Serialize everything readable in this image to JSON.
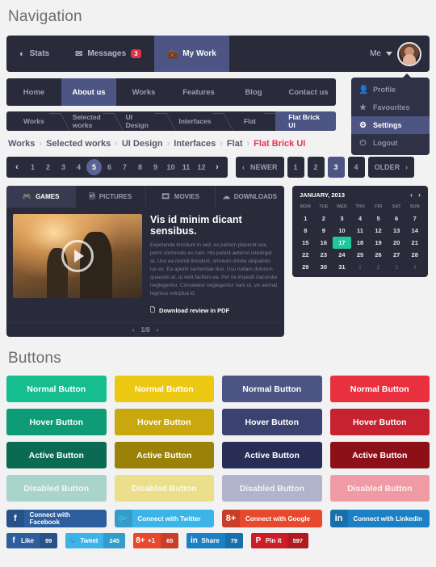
{
  "sections": {
    "navigation_title": "Navigation",
    "buttons_title": "Buttons"
  },
  "topbar": {
    "items": [
      {
        "label": "Stats",
        "icon": "chart-icon",
        "badge": null,
        "active": false
      },
      {
        "label": "Messages",
        "icon": "envelope-icon",
        "badge": "3",
        "active": false
      },
      {
        "label": "My Work",
        "icon": "briefcase-icon",
        "badge": null,
        "active": true
      }
    ],
    "user_label": "Me"
  },
  "dropdown": {
    "items": [
      {
        "label": "Profile",
        "icon": "user-icon",
        "active": false
      },
      {
        "label": "Favourites",
        "icon": "star-icon",
        "active": false
      },
      {
        "label": "Settings",
        "icon": "gear-icon",
        "active": true
      },
      {
        "label": "Logout",
        "icon": "power-icon",
        "active": false
      }
    ]
  },
  "mainnav": {
    "items": [
      {
        "label": "Home",
        "active": false
      },
      {
        "label": "About us",
        "active": true
      },
      {
        "label": "Works",
        "active": false
      },
      {
        "label": "Features",
        "active": false
      },
      {
        "label": "Blog",
        "active": false
      },
      {
        "label": "Contact us",
        "active": false
      }
    ]
  },
  "arrowbar": {
    "items": [
      {
        "label": "Works",
        "active": false
      },
      {
        "label": "Selected works",
        "active": false
      },
      {
        "label": "UI Design",
        "active": false
      },
      {
        "label": "Interfaces",
        "active": false
      },
      {
        "label": "Flat",
        "active": false
      },
      {
        "label": "Flat Brick UI",
        "active": true
      }
    ]
  },
  "crumbs": {
    "items": [
      "Works",
      "Selected works",
      "UI Design",
      "Interfaces",
      "Flat"
    ],
    "current": "Flat Brick UI",
    "separator": "›"
  },
  "pagination": {
    "prev_icon": "‹",
    "next_icon": "›",
    "pages": [
      "1",
      "2",
      "3",
      "4",
      "5",
      "6",
      "7",
      "8",
      "9",
      "10",
      "11",
      "12"
    ],
    "selected": "5"
  },
  "pagination2": {
    "newer_label": "NEWER",
    "older_label": "OLDER",
    "prev_icon": "‹",
    "next_icon": "›",
    "pages": [
      "1",
      "2",
      "3",
      "4"
    ],
    "selected": "3"
  },
  "media": {
    "tabs": [
      {
        "label": "GAMES",
        "icon": "gamepad-icon",
        "active": true
      },
      {
        "label": "PICTURES",
        "icon": "image-icon",
        "active": false
      },
      {
        "label": "MOVIES",
        "icon": "film-icon",
        "active": false
      },
      {
        "label": "DOWNLOADS",
        "icon": "download-cloud-icon",
        "active": false
      }
    ],
    "title": "Vis id minim dicant sensibus.",
    "body": "Expetenda tincidunt in sed, ex partem placerat sea, porro commodo ex nam. His putant aeterno intellegat at. Usu ea mundi tincidunt, omnium virtute aliquando ius ex. Ea aperiri sententiae duo. Usu nullam dolorum quaestio at, ut velit facilisis ea. Per ne impedit iracundia neglegentur. Consetetur neglegentur nam ut, vis animal legimus voluptua id.",
    "pdf_label": "Download review in PDF",
    "slide_counter": "1/8",
    "prev_icon": "‹",
    "next_icon": "›"
  },
  "calendar": {
    "title": "JANUARY, 2013",
    "prev_icon": "‹",
    "next_icon": "›",
    "dow": [
      "MON",
      "TUE",
      "WED",
      "THU",
      "FRI",
      "SAT",
      "SUN"
    ],
    "days": [
      {
        "n": "1"
      },
      {
        "n": "2"
      },
      {
        "n": "3"
      },
      {
        "n": "4"
      },
      {
        "n": "5"
      },
      {
        "n": "6"
      },
      {
        "n": "7"
      },
      {
        "n": "8"
      },
      {
        "n": "9"
      },
      {
        "n": "10"
      },
      {
        "n": "11"
      },
      {
        "n": "12"
      },
      {
        "n": "13"
      },
      {
        "n": "14"
      },
      {
        "n": "15"
      },
      {
        "n": "16"
      },
      {
        "n": "17",
        "selected": true
      },
      {
        "n": "18"
      },
      {
        "n": "19"
      },
      {
        "n": "20"
      },
      {
        "n": "21"
      },
      {
        "n": "22"
      },
      {
        "n": "23"
      },
      {
        "n": "24"
      },
      {
        "n": "25"
      },
      {
        "n": "26"
      },
      {
        "n": "27"
      },
      {
        "n": "28"
      },
      {
        "n": "29"
      },
      {
        "n": "30"
      },
      {
        "n": "31"
      },
      {
        "n": "1",
        "muted": true
      },
      {
        "n": "2",
        "muted": true
      },
      {
        "n": "3",
        "muted": true
      },
      {
        "n": "4",
        "muted": true
      }
    ],
    "selected_color": "#1ec9a0"
  },
  "buttons": {
    "rows": [
      {
        "state": "Normal Button",
        "colors": [
          "#15bd8f",
          "#edc813",
          "#4d5584",
          "#e8303f"
        ]
      },
      {
        "state": "Hover Button",
        "colors": [
          "#0e9c76",
          "#c9a80d",
          "#3b4270",
          "#c62230"
        ]
      },
      {
        "state": "Active Button",
        "colors": [
          "#0a6b52",
          "#9a8208",
          "#272d55",
          "#8c1018"
        ]
      },
      {
        "state": "Disabled Button",
        "colors": [
          "#a9d4c9",
          "#ecdf8b",
          "#b0b4cc",
          "#f09aa5"
        ]
      }
    ]
  },
  "social": {
    "connect": [
      {
        "label": "Connect with Facebook",
        "icon": "f",
        "color": "#2d5e9e"
      },
      {
        "label": "Connect with Twitter",
        "icon": "🐦",
        "color": "#3cb4e8"
      },
      {
        "label": "Connect with Google",
        "icon": "8+",
        "color": "#e6492d"
      },
      {
        "label": "Connect with Linkedin",
        "icon": "in",
        "color": "#1c81c4"
      }
    ],
    "shares": [
      {
        "label": "Like",
        "count": "99",
        "icon": "f",
        "color": "#2d5e9e"
      },
      {
        "label": "Tweet",
        "count": "245",
        "icon": "🐦",
        "color": "#3cb4e8"
      },
      {
        "label": "+1",
        "count": "65",
        "icon": "8+",
        "color": "#e6492d"
      },
      {
        "label": "Share",
        "count": "79",
        "icon": "in",
        "color": "#1c81c4"
      },
      {
        "label": "Pin it",
        "count": "597",
        "icon": "P",
        "color": "#cb1f28"
      }
    ]
  }
}
